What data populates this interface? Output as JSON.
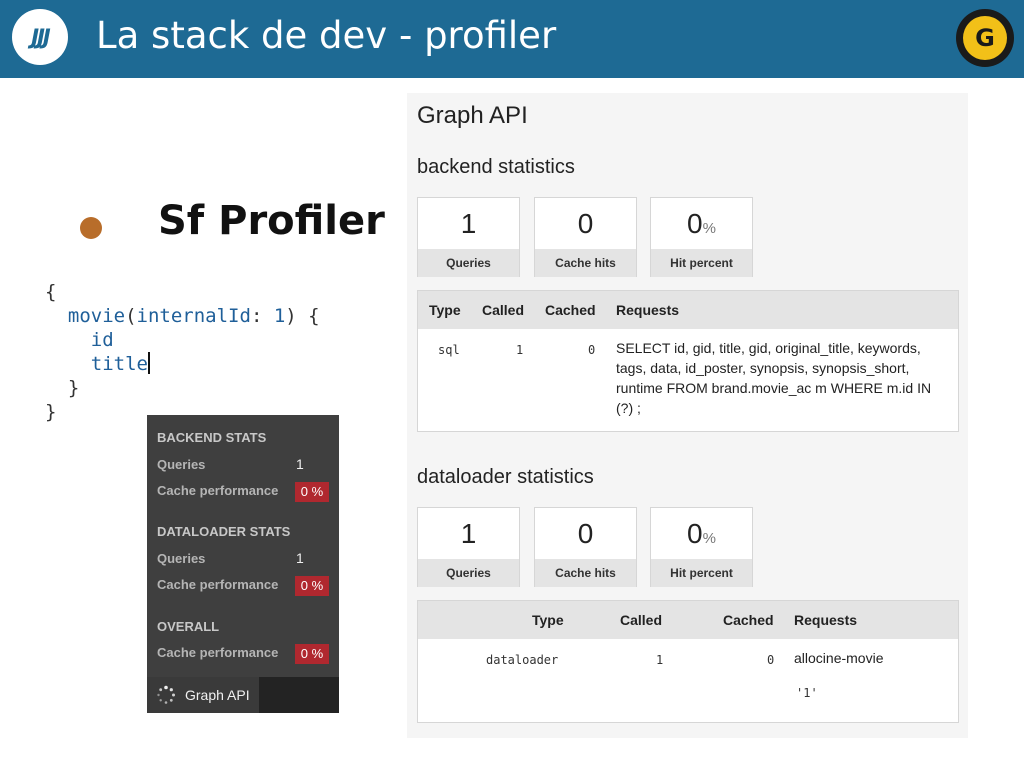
{
  "header": {
    "title": "La stack de dev - profiler",
    "logo_left_text": "JJJ",
    "logo_right_text": "G"
  },
  "bullet": {
    "text": "Sf Profiler"
  },
  "code": {
    "lines": [
      "{",
      "  movie(internalId: 1) {",
      "    id",
      "    title",
      "  }",
      "}"
    ],
    "query_field": "movie",
    "argument_name": "internalId",
    "argument_value": "1",
    "fields": [
      "id",
      "title"
    ]
  },
  "toolbar": {
    "backend_heading": "BACKEND STATS",
    "backend_queries_label": "Queries",
    "backend_queries_value": "1",
    "backend_cache_label": "Cache performance",
    "backend_cache_value": "0 %",
    "dataloader_heading": "DATALOADER STATS",
    "dataloader_queries_label": "Queries",
    "dataloader_queries_value": "1",
    "dataloader_cache_label": "Cache performance",
    "dataloader_cache_value": "0 %",
    "overall_heading": "OVERALL",
    "overall_cache_label": "Cache performance",
    "overall_cache_value": "0 %",
    "footer_label": "Graph API"
  },
  "graph_panel": {
    "title": "Graph API",
    "backend": {
      "heading": "backend statistics",
      "metrics": [
        {
          "value": "1",
          "unit": "",
          "label": "Queries"
        },
        {
          "value": "0",
          "unit": "",
          "label": "Cache hits"
        },
        {
          "value": "0",
          "unit": "%",
          "label": "Hit percent"
        }
      ],
      "table": {
        "headers": [
          "Type",
          "Called",
          "Cached",
          "Requests"
        ],
        "row": {
          "type": "sql",
          "called": "1",
          "cached": "0",
          "request_lines": [
            "SELECT id, gid, title, gid, original_title, keywords,",
            "tags, data, id_poster, synopsis, synopsis_short,",
            "runtime FROM brand.movie_ac m WHERE m.id IN",
            "(?) ;"
          ]
        }
      }
    },
    "dataloader": {
      "heading": "dataloader statistics",
      "metrics": [
        {
          "value": "1",
          "unit": "",
          "label": "Queries"
        },
        {
          "value": "0",
          "unit": "",
          "label": "Cache hits"
        },
        {
          "value": "0",
          "unit": "%",
          "label": "Hit percent"
        }
      ],
      "table": {
        "headers": [
          "Type",
          "Called",
          "Cached",
          "Requests"
        ],
        "row": {
          "type": "dataloader",
          "called": "1",
          "cached": "0",
          "request": "allocine-movie",
          "request_arg": "'1'"
        }
      }
    }
  },
  "colors": {
    "header_bg": "#1e6a94",
    "bullet": "#b86d2a",
    "badge_red": "#b0282f",
    "code_blue": "#1f5f99"
  }
}
